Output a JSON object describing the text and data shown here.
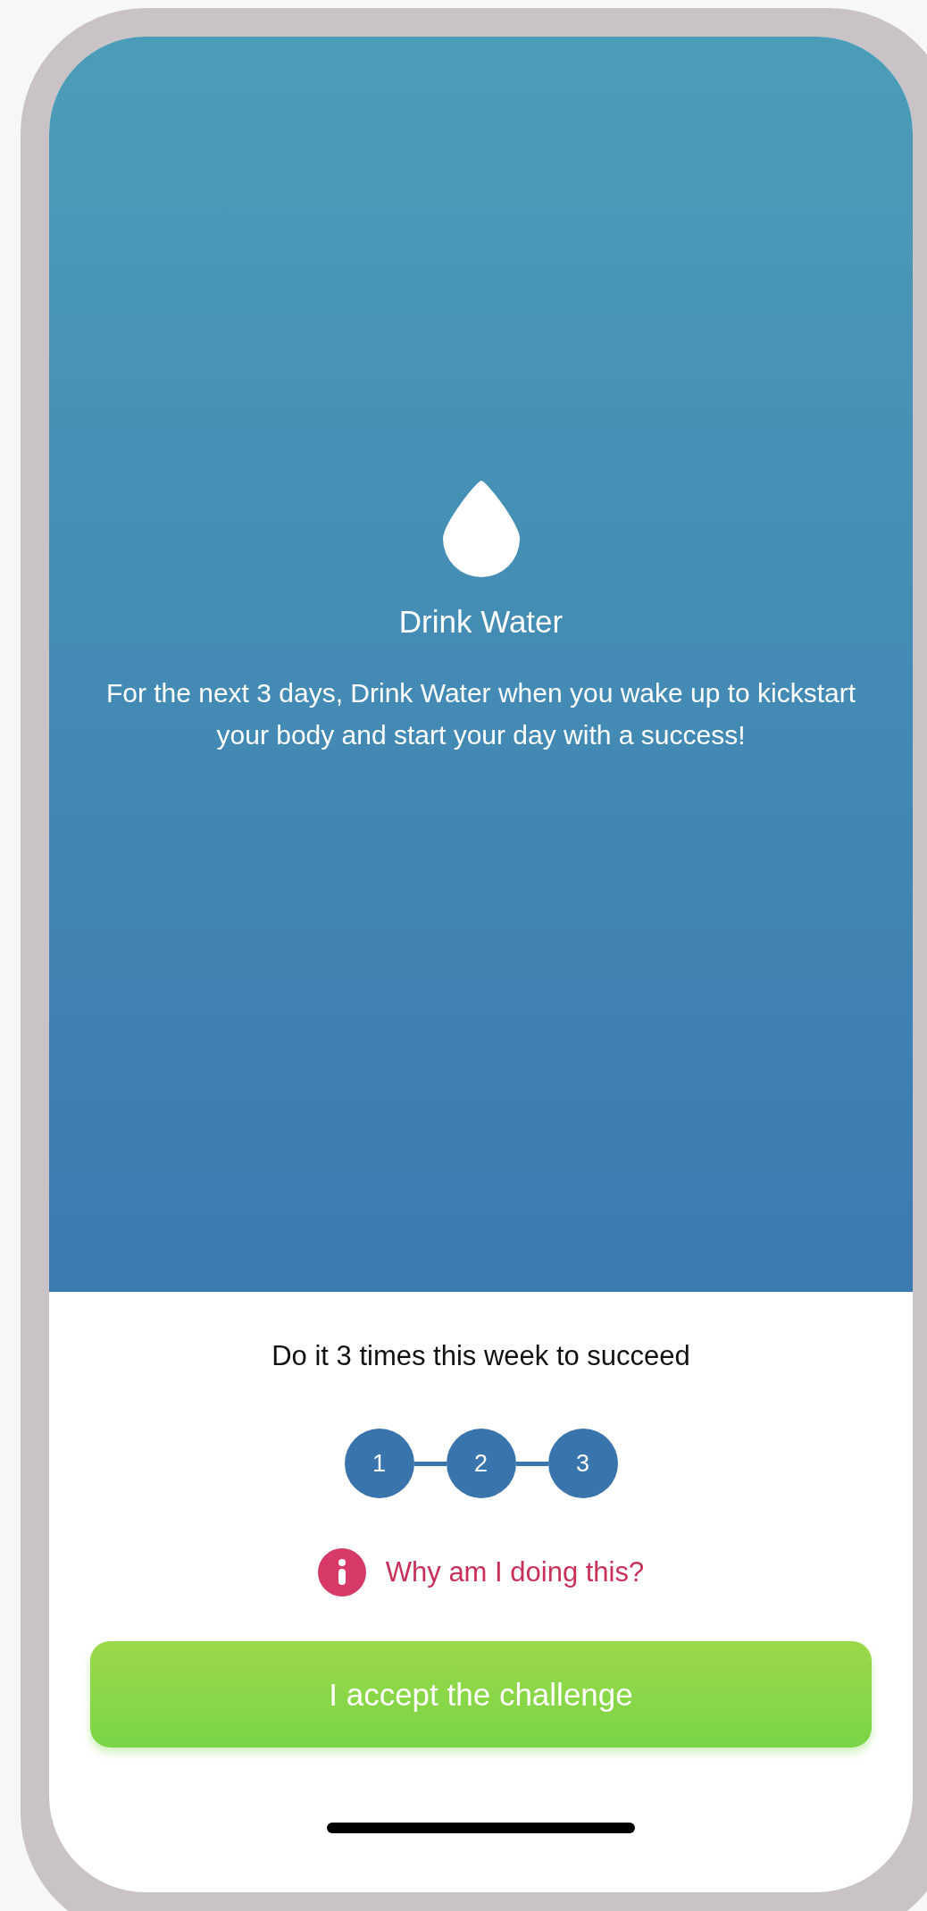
{
  "challenge": {
    "title": "Drink Water",
    "description": "For the next 3 days, Drink Water when you wake up to kickstart your body and start your day with a success!"
  },
  "goal": "Do it 3 times this week to succeed",
  "steps": [
    {
      "label": "1"
    },
    {
      "label": "2"
    },
    {
      "label": "3"
    }
  ],
  "info_link": "Why am I doing this?",
  "accept_button": "I accept the challenge"
}
